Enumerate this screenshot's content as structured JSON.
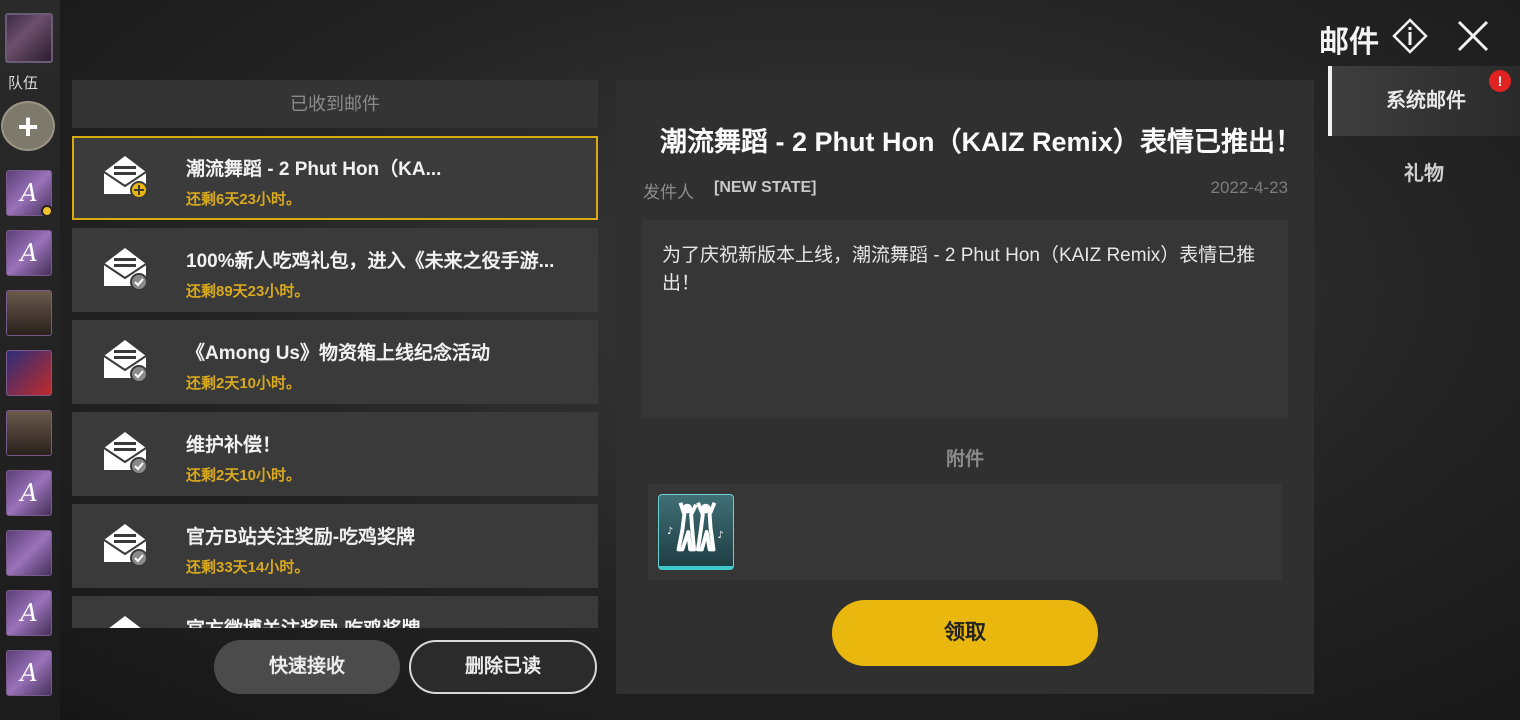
{
  "header": {
    "title": "邮件"
  },
  "left_strip": {
    "team_label": "队伍",
    "add_label": "+"
  },
  "mail_list": {
    "header": "已收到邮件",
    "items": [
      {
        "title": "潮流舞蹈 - 2 Phut Hon（KA...",
        "remaining": "还剩6天23小时。",
        "status": "new"
      },
      {
        "title": "100%新人吃鸡礼包，进入《未来之役手游...",
        "remaining": "还剩89天23小时。",
        "status": "read"
      },
      {
        "title": "《Among Us》物资箱上线纪念活动",
        "remaining": "还剩2天10小时。",
        "status": "read"
      },
      {
        "title": "维护补偿！",
        "remaining": "还剩2天10小时。",
        "status": "read"
      },
      {
        "title": "官方B站关注奖励-吃鸡奖牌",
        "remaining": "还剩33天14小时。",
        "status": "read"
      },
      {
        "title": "官方微博关注奖励-吃鸡奖牌",
        "remaining": "",
        "status": "read"
      }
    ],
    "quick_receive": "快速接收",
    "delete_read": "删除已读"
  },
  "detail": {
    "title": "潮流舞蹈 - 2 Phut Hon（KAIZ Remix）表情已推出！",
    "sender_label": "发件人",
    "sender_name": "[NEW STATE]",
    "date": "2022-4-23",
    "body": "为了庆祝新版本上线，潮流舞蹈 - 2 Phut Hon（KAIZ Remix）表情已推出！",
    "attachment_label": "附件",
    "attachment_icon": "dance-emote-icon",
    "claim_button": "领取"
  },
  "tabs": [
    {
      "label": "系统邮件",
      "active": true,
      "badge": "!"
    },
    {
      "label": "礼物",
      "active": false
    }
  ],
  "colors": {
    "accent": "#e9b70e",
    "remaining": "#d9a91d",
    "badge": "#e02222",
    "attachment_border": "#3ec9cc"
  }
}
